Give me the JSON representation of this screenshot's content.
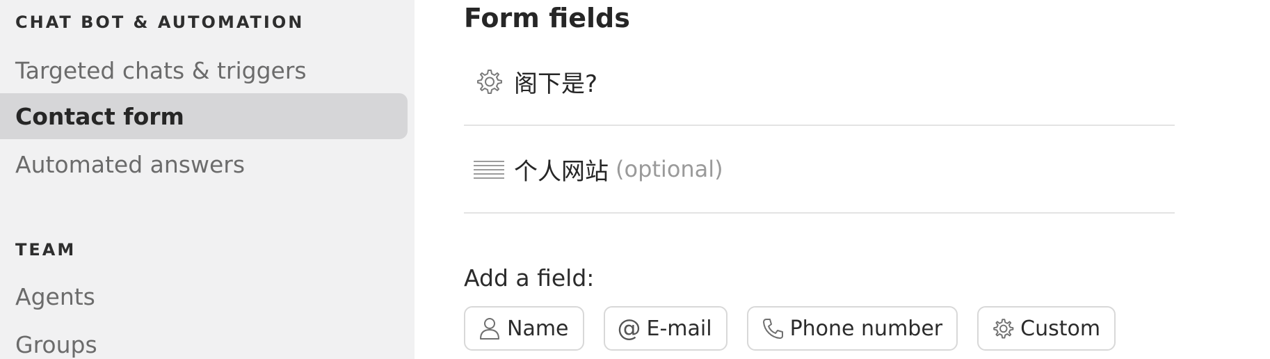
{
  "sidebar": {
    "sections": [
      {
        "heading": "CHAT BOT & AUTOMATION",
        "items": [
          {
            "label": "Targeted chats & triggers"
          },
          {
            "label": "Contact form",
            "active": true
          },
          {
            "label": "Automated answers"
          }
        ]
      },
      {
        "heading": "TEAM",
        "items": [
          {
            "label": "Agents"
          },
          {
            "label": "Groups"
          }
        ]
      }
    ]
  },
  "main": {
    "title": "Form fields",
    "fields": [
      {
        "icon": "gear-icon",
        "label": "阁下是?"
      },
      {
        "icon": "text-lines-icon",
        "label": "个人网站",
        "optional": "(optional)"
      }
    ],
    "add_field": {
      "label": "Add a field:",
      "buttons": [
        {
          "icon": "person-icon",
          "label": "Name"
        },
        {
          "icon": "at-icon",
          "glyph": "@",
          "label": "E-mail"
        },
        {
          "icon": "phone-icon",
          "label": "Phone number"
        },
        {
          "icon": "gear-icon",
          "label": "Custom"
        }
      ]
    }
  },
  "colors": {
    "sidebar_bg": "#f1f1f2",
    "active_item_bg": "#d6d6d8",
    "divider": "#e3e3e3",
    "muted_text": "#9a9a9a"
  }
}
